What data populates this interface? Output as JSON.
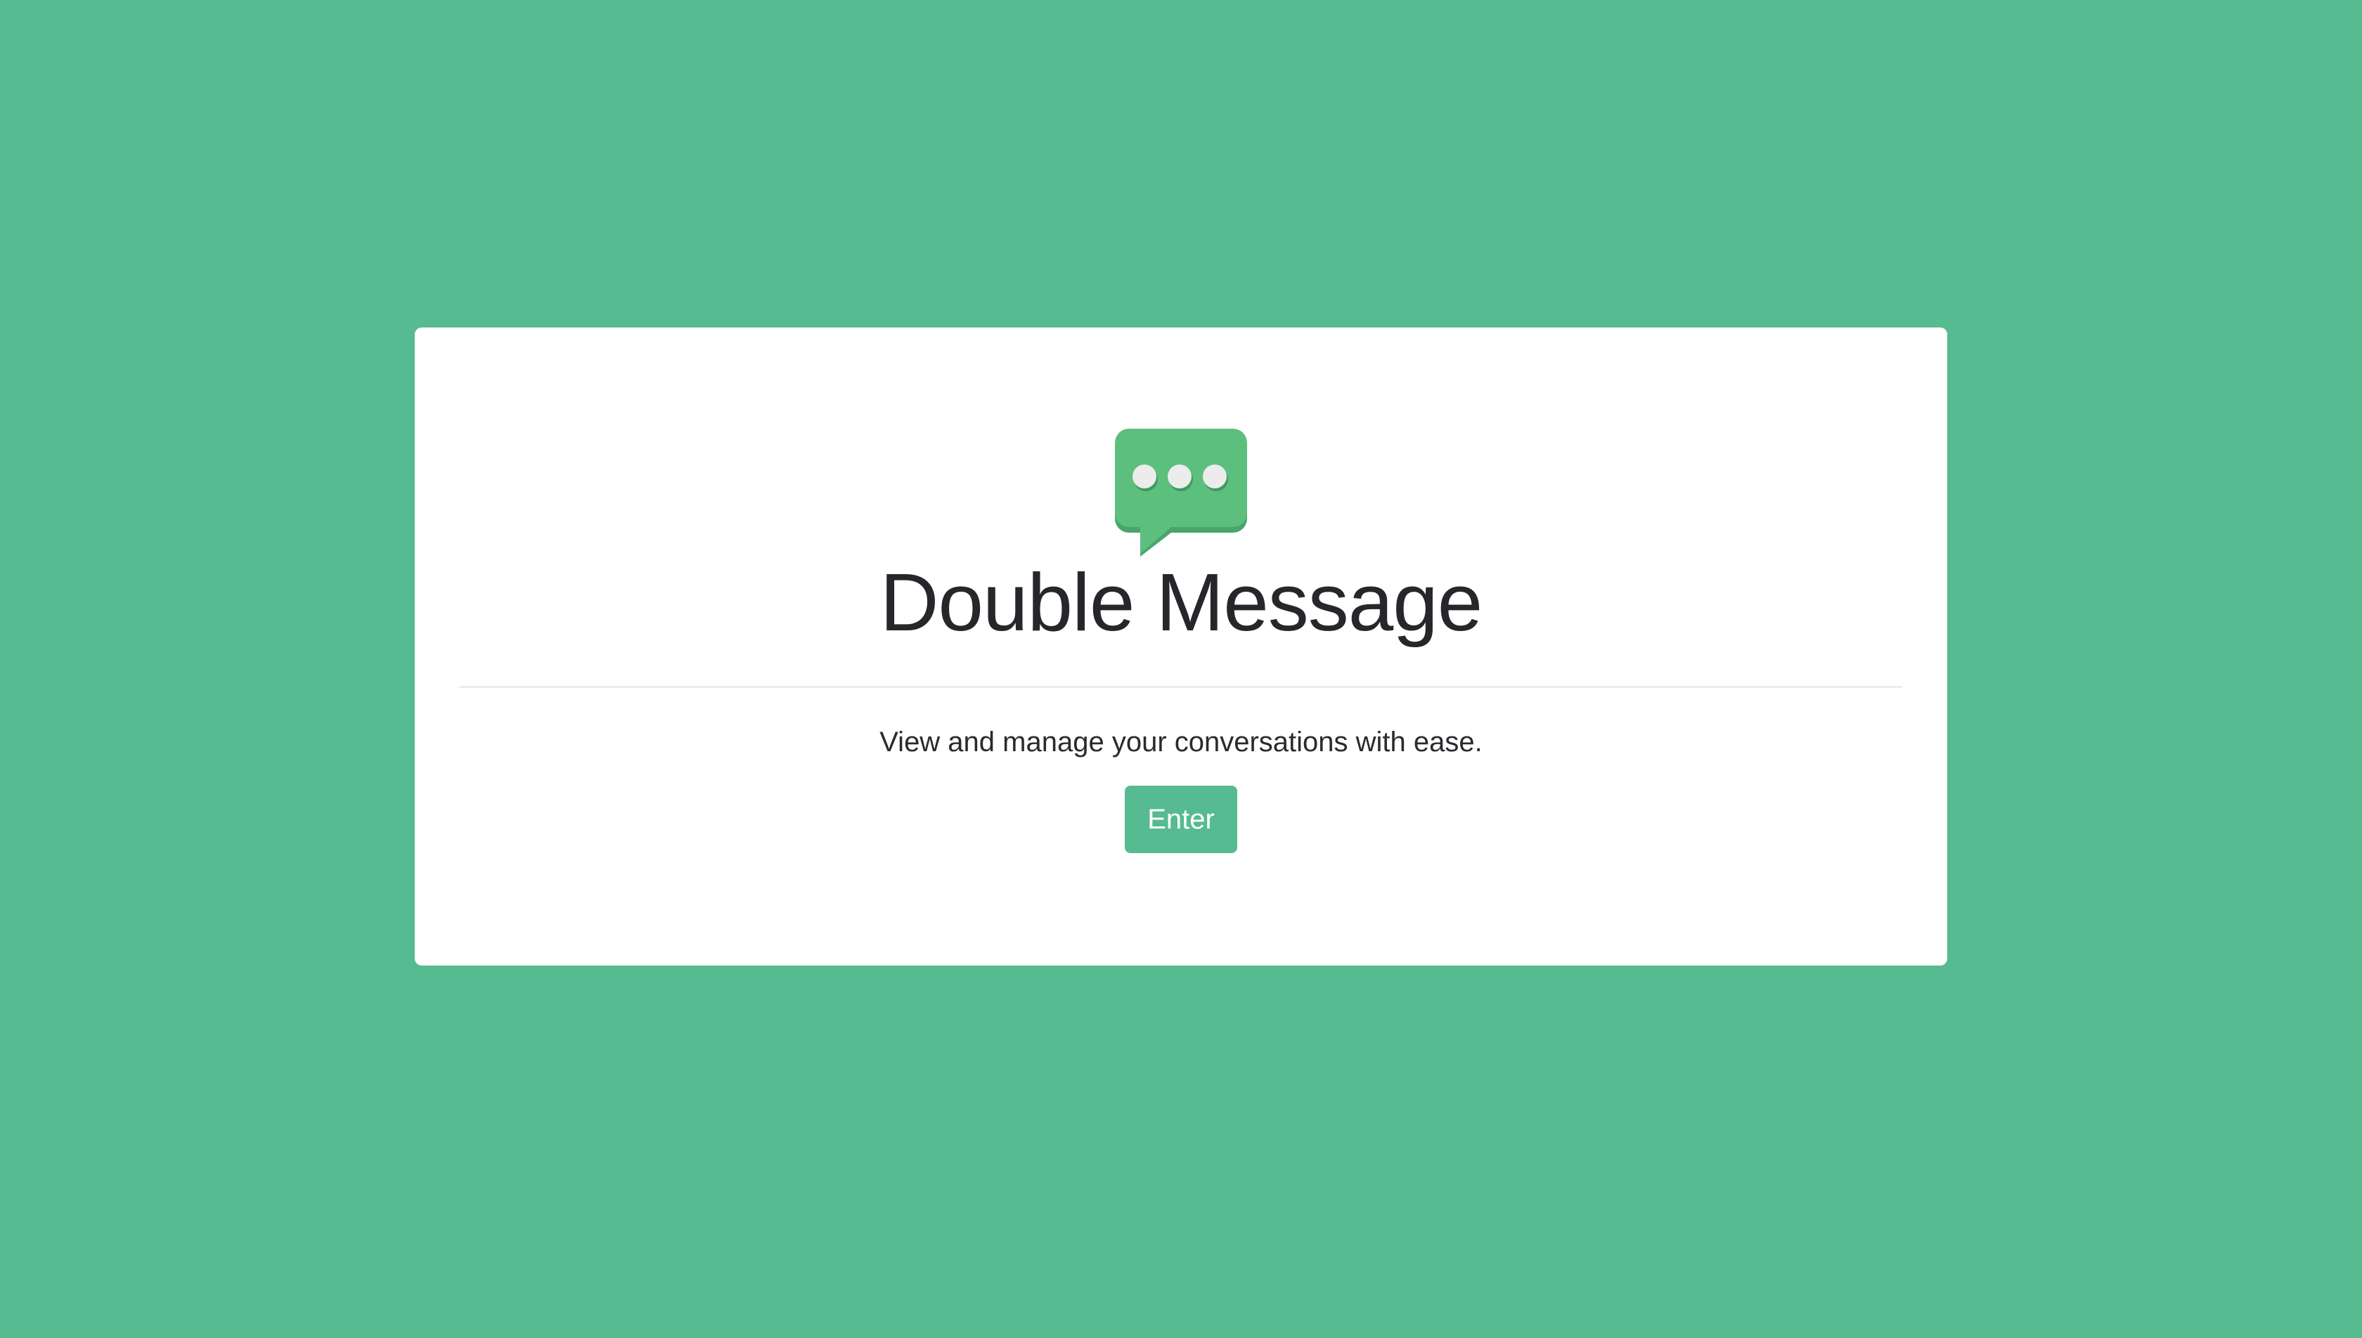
{
  "app": {
    "title": "Double Message",
    "tagline": "View and manage your conversations with ease.",
    "enter_label": "Enter"
  },
  "icons": {
    "logo": "speech-bubble-icon"
  },
  "colors": {
    "background": "#56bb90",
    "card": "#ffffff",
    "accent": "#56bb90",
    "bubble": "#5cbf7d",
    "bubble_shadow": "#4aa56a",
    "dots": "#ececec",
    "title_text": "#26262b"
  }
}
